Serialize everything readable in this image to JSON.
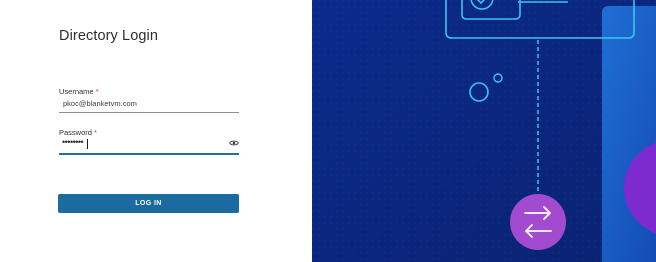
{
  "login": {
    "title": "Directory Login",
    "username_label": "Username",
    "username_value": "pkoc@blanketvm.com",
    "password_label": "Password",
    "password_mask": "••••••••",
    "required_marker": "*",
    "login_button": "LOG IN"
  },
  "colors": {
    "accent": "#1b6aa0",
    "focus": "#1f6fb5",
    "required": "#d2302f",
    "illustration_bg": "#0b2a8c",
    "cyan_line": "#37c6f0",
    "purple_circle": "#a34bd0"
  },
  "icons": {
    "password_toggle": "eye-icon",
    "sync": "arrows-exchange-icon",
    "check": "check-icon"
  }
}
